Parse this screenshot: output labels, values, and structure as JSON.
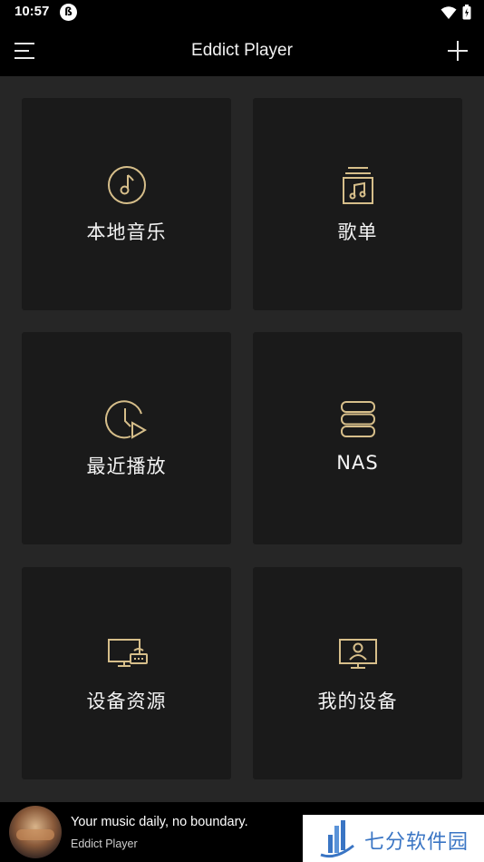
{
  "status_bar": {
    "time": "10:57"
  },
  "app_bar": {
    "title": "Eddict Player"
  },
  "tiles": [
    {
      "label": "本地音乐",
      "icon": "music-disc-icon"
    },
    {
      "label": "歌单",
      "icon": "playlist-icon"
    },
    {
      "label": "最近播放",
      "icon": "recent-play-icon"
    },
    {
      "label": "NAS",
      "icon": "nas-server-icon"
    },
    {
      "label": "设备资源",
      "icon": "device-resources-icon"
    },
    {
      "label": "我的设备",
      "icon": "my-device-icon"
    }
  ],
  "player": {
    "title": "Your music daily, no boundary.",
    "subtitle": "Eddict Player"
  },
  "watermark": {
    "text": "七分软件园"
  },
  "colors": {
    "background": "#262626",
    "tile": "#1a1a1a",
    "icon_gold": "#d6be8a",
    "bar": "#000000",
    "watermark_blue": "#3a75c4"
  }
}
